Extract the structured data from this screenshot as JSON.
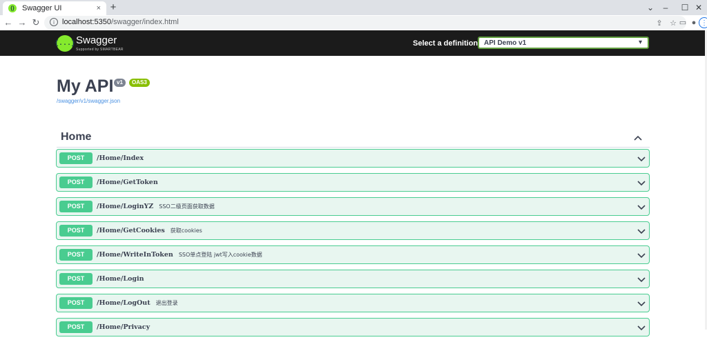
{
  "browser": {
    "tab_title": "Swagger UI",
    "tab_close": "×",
    "new_tab": "+",
    "url_host": "localhost:5350",
    "url_path": "/swagger/index.html",
    "win_min": "–",
    "win_max": "☐",
    "win_close": "✕"
  },
  "topbar": {
    "brand": "Swagger",
    "brand_sub": "Supported by SMARTBEAR",
    "logo_glyph": "{...}",
    "definition_label": "Select a definition",
    "definition_value": "API Demo v1"
  },
  "info": {
    "title": "My API",
    "version": "v1",
    "oas": "OAS3",
    "spec_url": "/swagger/v1/swagger.json"
  },
  "tag": {
    "name": "Home"
  },
  "operations": [
    {
      "method": "POST",
      "path": "/Home/Index",
      "summary": ""
    },
    {
      "method": "POST",
      "path": "/Home/GetToken",
      "summary": ""
    },
    {
      "method": "POST",
      "path": "/Home/LoginYZ",
      "summary": "SSO二级页面获取数据"
    },
    {
      "method": "POST",
      "path": "/Home/GetCookies",
      "summary": "获取cookies"
    },
    {
      "method": "POST",
      "path": "/Home/WriteInToken",
      "summary": "SSO单点登陆 jwt写入cookie数据"
    },
    {
      "method": "POST",
      "path": "/Home/Login",
      "summary": ""
    },
    {
      "method": "POST",
      "path": "/Home/LogOut",
      "summary": "退出登录"
    },
    {
      "method": "POST",
      "path": "/Home/Privacy",
      "summary": ""
    }
  ],
  "colors": {
    "post": "#49cc90",
    "post_bg": "#e8f6f0",
    "topbar_bg": "#1b1b1b",
    "swagger_green": "#85ea2d"
  }
}
